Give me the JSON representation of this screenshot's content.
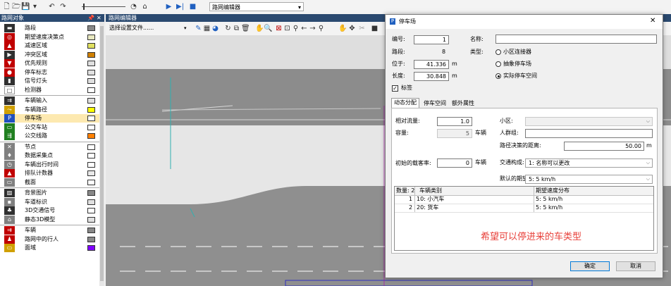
{
  "toolbar": {
    "view_combo": "路网编辑器",
    "view_combo_arrow": "▾"
  },
  "left_panel": {
    "title": "路网对象",
    "pin": "📌",
    "close": "✕",
    "items": [
      {
        "label": "路段",
        "icon_color": "#303030",
        "swatch": "#888888"
      },
      {
        "label": "期望速度决策点",
        "icon_color": "#c00000",
        "swatch": "#e8e8c0"
      },
      {
        "label": "减速区域",
        "icon_color": "#c00000",
        "swatch": "#e0e060"
      },
      {
        "label": "冲突区域",
        "icon_color": "#303030",
        "swatch": "#d08000"
      },
      {
        "label": "优先规则",
        "icon_color": "#c00000",
        "swatch": "#e0e0e0"
      },
      {
        "label": "停车标志",
        "icon_color": "#c00000",
        "swatch": "#e0e0e0"
      },
      {
        "label": "信号灯头",
        "icon_color": "#303030",
        "swatch": "#e0e0e0"
      },
      {
        "label": "检测器",
        "icon_color": "#ffffff",
        "swatch": "#ffffff"
      },
      {
        "label": "车辆输入",
        "icon_color": "#303030",
        "swatch": "#e0e0e0"
      },
      {
        "label": "车辆路径",
        "icon_color": "#d0a000",
        "swatch": "#ffff00"
      },
      {
        "label": "停车场",
        "icon_color": "#2050c0",
        "swatch": "#ffffff"
      },
      {
        "label": "公交车站",
        "icon_color": "#208020",
        "swatch": "#ffffff"
      },
      {
        "label": "公交线路",
        "icon_color": "#208020",
        "swatch": "#ff8000"
      },
      {
        "label": "节点",
        "icon_color": "#808080",
        "swatch": "#ffffff"
      },
      {
        "label": "数据采集点",
        "icon_color": "#808080",
        "swatch": "#ffffff"
      },
      {
        "label": "车辆出行时间",
        "icon_color": "#808080",
        "swatch": "#ffffff"
      },
      {
        "label": "排队计数器",
        "icon_color": "#c00000",
        "swatch": "#e8e8e8"
      },
      {
        "label": "截面",
        "icon_color": "#808080",
        "swatch": "#ffffff"
      },
      {
        "label": "背景图片",
        "icon_color": "#303030",
        "swatch": "#888888"
      },
      {
        "label": "车道标识",
        "icon_color": "#808080",
        "swatch": "#e0e0e0"
      },
      {
        "label": "3D交通信号",
        "icon_color": "#303030",
        "swatch": "#ffffff"
      },
      {
        "label": "静态3D模型",
        "icon_color": "#808080",
        "swatch": "#e0e0e0"
      },
      {
        "label": "车辆",
        "icon_color": "#c00000",
        "swatch": "#888888"
      },
      {
        "label": "路网中的行人",
        "icon_color": "#c00000",
        "swatch": "#888888"
      },
      {
        "label": "面域",
        "icon_color": "#d0a000",
        "swatch": "#8000ff"
      }
    ]
  },
  "editor": {
    "title": "路网编辑器",
    "settings_combo": "选择设置文件......"
  },
  "dialog": {
    "title": "停车场",
    "close": "✕",
    "id_label": "编号:",
    "id_value": "1",
    "name_label": "名称:",
    "name_value": "",
    "link_label": "路段:",
    "link_value": "8",
    "type_label": "类型:",
    "types": [
      "小区连接器",
      "抽象停车场",
      "实际停车空间"
    ],
    "selected_type": 2,
    "pos_label": "位于:",
    "pos_value": "41.336",
    "pos_unit": "m",
    "len_label": "长度:",
    "len_value": "30.848",
    "len_unit": "m",
    "label_check": "标签",
    "label_checked": true,
    "tabs": [
      "动态分配",
      "停车空间",
      "额外属性"
    ],
    "active_tab": 0,
    "rel_flow_label": "相对流量:",
    "rel_flow_value": "1.0",
    "capacity_label": "容量:",
    "capacity_value": "5",
    "capacity_unit": "车辆",
    "zone_label": "小区:",
    "zone_value": "",
    "attract_label": "人群组:",
    "attract_value": "",
    "dist_label": "路径决策的距离:",
    "dist_value": "50.00",
    "dist_unit": "m",
    "init_occ_label": "初始的载客率:",
    "init_occ_value": "0",
    "init_occ_unit": "车辆",
    "traffic_comp_label": "交通构成:",
    "traffic_comp_value": "1: 名称可以更改",
    "default_speed_label": "默认的期望速度:",
    "default_speed_value": "5: 5 km/h",
    "table": {
      "count_header": "数量: 2",
      "col1": "车辆类别",
      "col2": "期望速度分布",
      "rows": [
        {
          "n": "1",
          "cls": "10: 小汽车",
          "speed": "5: 5 km/h"
        },
        {
          "n": "2",
          "cls": "20: 货车",
          "speed": "5: 5 km/h"
        }
      ]
    },
    "annotation": "希望可以停进来的车类型",
    "annotation_color": "#e8403a",
    "ok": "确定",
    "cancel": "取消"
  }
}
